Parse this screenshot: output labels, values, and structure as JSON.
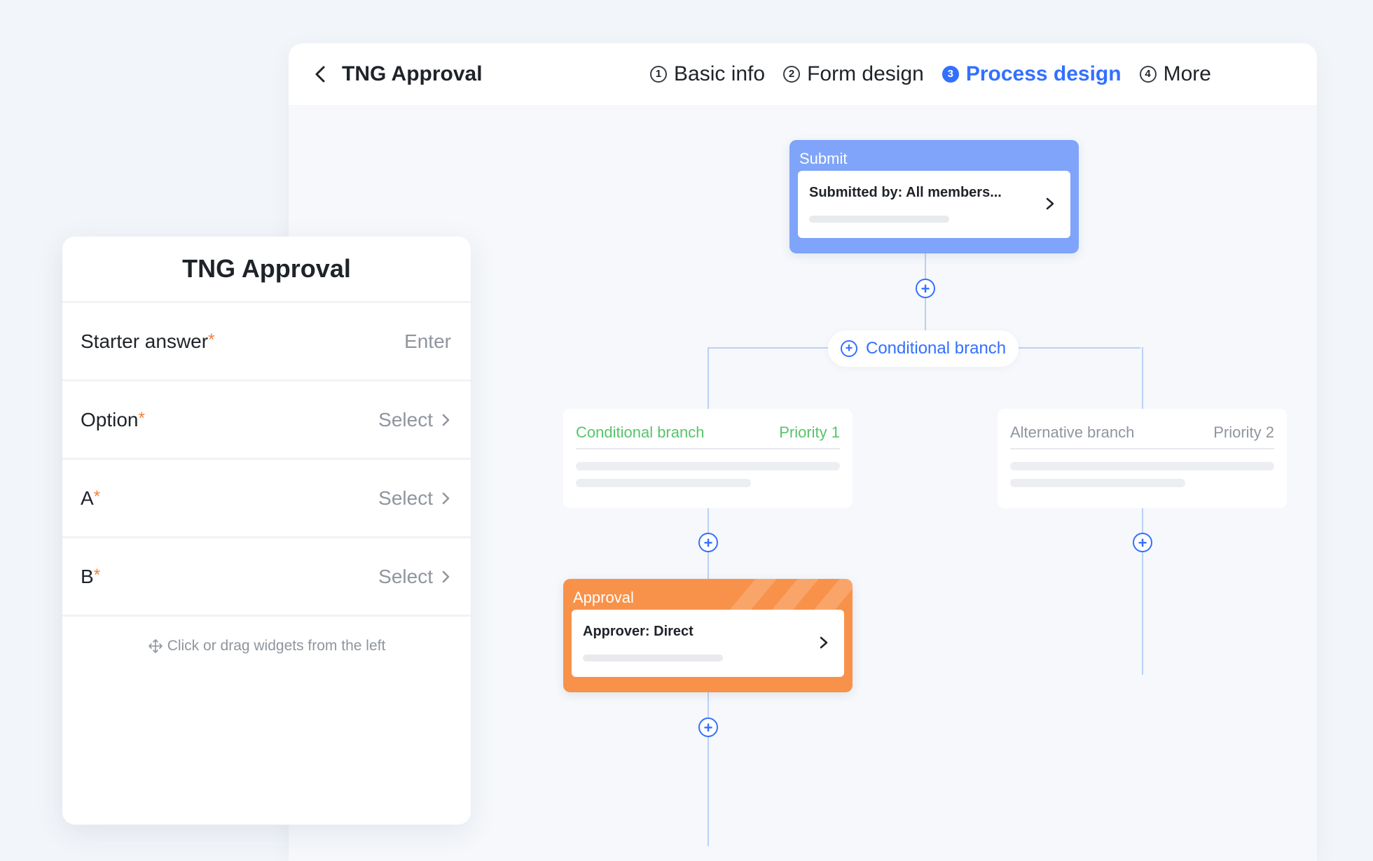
{
  "header": {
    "title": "TNG Approval",
    "steps": [
      {
        "num": "1",
        "label": "Basic info"
      },
      {
        "num": "2",
        "label": "Form design"
      },
      {
        "num": "3",
        "label": "Process design"
      },
      {
        "num": "4",
        "label": "More"
      }
    ],
    "active_step": 3
  },
  "flow": {
    "submit": {
      "title": "Submit",
      "text": "Submitted by: All members..."
    },
    "conditional_button": "Conditional branch",
    "branches": [
      {
        "name": "Conditional branch",
        "priority": "Priority 1"
      },
      {
        "name": "Alternative branch",
        "priority": "Priority 2"
      }
    ],
    "approval": {
      "title": "Approval",
      "text": "Approver: Direct"
    }
  },
  "form": {
    "title": "TNG Approval",
    "fields": [
      {
        "label": "Starter answer",
        "value": "Enter"
      },
      {
        "label": "Option",
        "value": "Select"
      },
      {
        "label": "A",
        "value": "Select"
      },
      {
        "label": "B",
        "value": "Select"
      }
    ],
    "hint": "Click or drag widgets from the left"
  },
  "colors": {
    "accent": "#3370ff",
    "submit_node": "#7fa4f9",
    "approval_node": "#f8924a",
    "branch_green": "#57c46b",
    "required": "#f5803e"
  }
}
